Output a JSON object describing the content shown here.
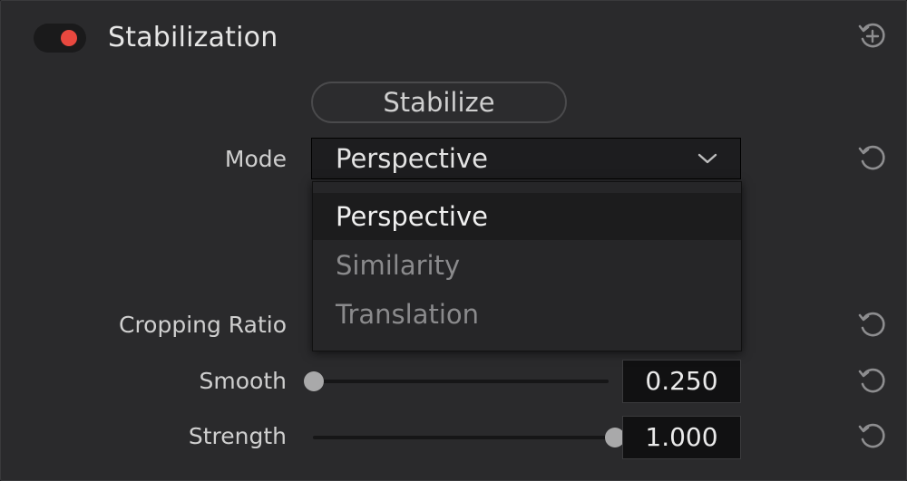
{
  "header": {
    "title": "Stabilization",
    "enabled": true,
    "toggle_color": "#e8483f"
  },
  "stabilize_button": {
    "label": "Stabilize"
  },
  "mode": {
    "label": "Mode",
    "value": "Perspective",
    "options": [
      "Perspective",
      "Similarity",
      "Translation"
    ],
    "selected_index": 0
  },
  "cropping_ratio": {
    "label": "Cropping Ratio"
  },
  "smooth": {
    "label": "Smooth",
    "value": "0.250",
    "slider_fraction": 0.0
  },
  "strength": {
    "label": "Strength",
    "value": "1.000",
    "slider_fraction": 1.0
  },
  "icons": {
    "header_reset": "reset-plus-icon",
    "row_reset": "reset-icon",
    "dropdown": "chevron-down-icon"
  }
}
